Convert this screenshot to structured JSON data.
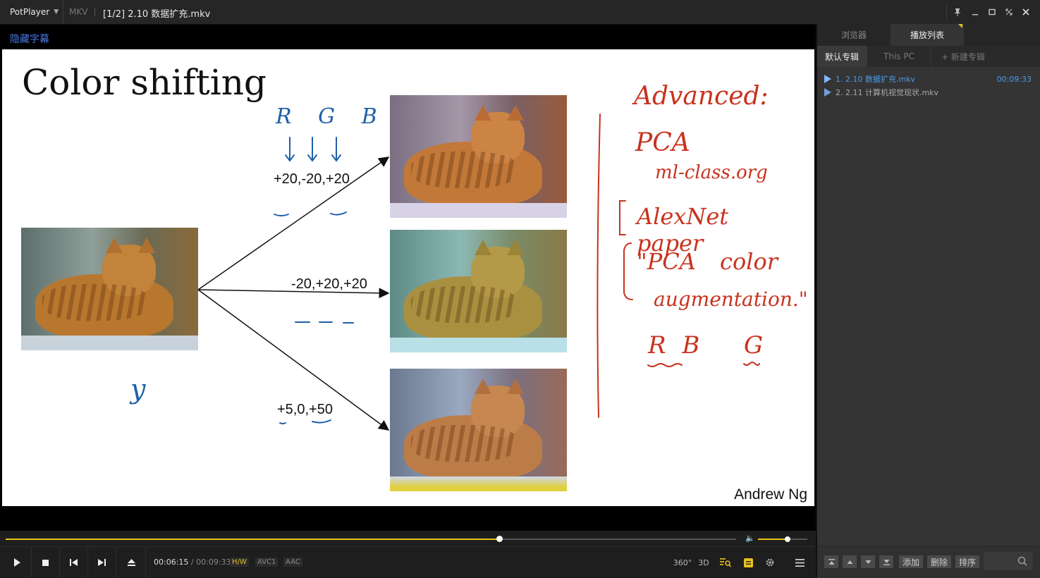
{
  "titlebar": {
    "app_name": "PotPlayer",
    "format": "MKV",
    "file_title": "[1/2] 2.10 数据扩充.mkv"
  },
  "video": {
    "subtitle_toggle": "隐藏字幕",
    "slide": {
      "title": "Color shifting",
      "author": "Andrew Ng",
      "shift_labels": [
        "+20,-20,+20",
        "-20,+20,+20",
        "+5,0,+50"
      ],
      "handwriting_left": {
        "rgb": "R G B",
        "y": "y"
      },
      "handwriting_right": {
        "l1": "Advanced:",
        "l2": "PCA",
        "l3": "ml-class.org",
        "l4": "AlexNet paper",
        "l5": "\"PCA color",
        "l6": "augmentation.\"",
        "l7": "R B",
        "l8": "G"
      }
    }
  },
  "controls": {
    "progress": 0.676,
    "volume": 0.6,
    "time_current": "00:06:15",
    "time_sep": "/",
    "time_total": "00:09:33",
    "tags": [
      "H/W",
      "AVC1",
      "AAC"
    ],
    "icons": [
      "360°",
      "3D"
    ]
  },
  "panel": {
    "tabs": [
      "浏览器",
      "播放列表"
    ],
    "subtabs": [
      "默认专辑",
      "This PC",
      "+ 新建专辑"
    ],
    "playlist": [
      {
        "title": "1. 2.10 数据扩充.mkv",
        "duration": "00:09:33"
      },
      {
        "title": "2. 2.11 计算机视觉现状.mkv",
        "duration": ""
      }
    ],
    "buttons": [
      "添加",
      "删除",
      "排序"
    ]
  },
  "colors": {
    "accent": "#e8c21a",
    "playlist_active": "#4a9ae8",
    "ink_blue": "#1f5fa8",
    "ink_red": "#c8321e"
  }
}
